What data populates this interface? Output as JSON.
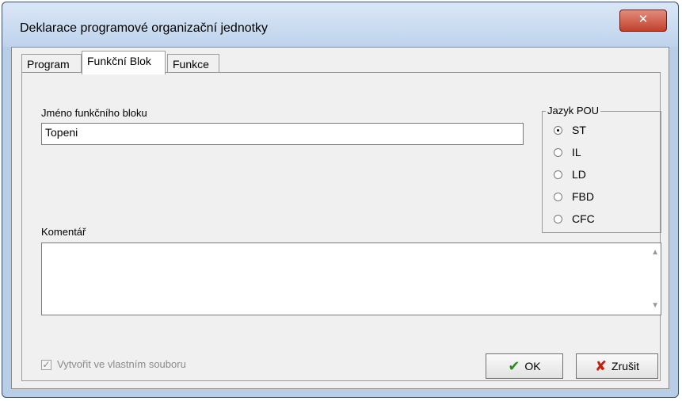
{
  "window": {
    "title": "Deklarace programové organizační jednotky",
    "close_glyph": "✕"
  },
  "tabs": [
    {
      "label": "Program",
      "active": false
    },
    {
      "label": "Funkční Blok",
      "active": true
    },
    {
      "label": "Funkce",
      "active": false
    }
  ],
  "form": {
    "name_label": "Jméno funkčního bloku",
    "name_value": "Topeni",
    "comment_label": "Komentář",
    "comment_value": ""
  },
  "language_group": {
    "title": "Jazyk POU",
    "options": [
      {
        "label": "ST",
        "checked": true
      },
      {
        "label": "IL",
        "checked": false
      },
      {
        "label": "LD",
        "checked": false
      },
      {
        "label": "FBD",
        "checked": false
      },
      {
        "label": "CFC",
        "checked": false
      }
    ]
  },
  "own_file_checkbox": {
    "label": "Vytvořit ve vlastním souboru",
    "checked": true,
    "disabled": true
  },
  "buttons": {
    "ok_label": "OK",
    "ok_icon": "checkmark-icon",
    "cancel_label": "Zrušit",
    "cancel_icon": "cross-icon"
  },
  "colors": {
    "ok_icon": "#2e8b1e",
    "cancel_icon": "#c0200c",
    "close_button": "#c1412c"
  }
}
